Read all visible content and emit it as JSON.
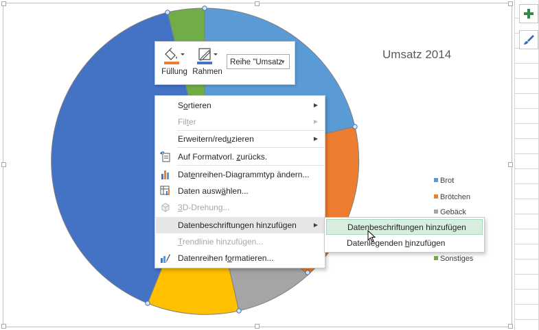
{
  "chart": {
    "title": "Umsatz 2014",
    "legend": [
      {
        "label": "Brot",
        "color": "#5b9bd5"
      },
      {
        "label": "Brötchen",
        "color": "#ed7d31"
      },
      {
        "label": "Gebäck",
        "color": "#a5a5a5"
      },
      {
        "label": "Sonstiges",
        "color": "#70ad47"
      }
    ]
  },
  "minibar": {
    "fill_label": "Füllung",
    "outline_label": "Rahmen",
    "series_select": "Reihe \"Umsatz"
  },
  "context_menu": {
    "items": [
      {
        "pre": "S",
        "u": "o",
        "post": "rtieren",
        "submenu": true,
        "disabled": false
      },
      {
        "pre": "Fil",
        "u": "t",
        "post": "er",
        "submenu": true,
        "disabled": true
      },
      {
        "pre": "Erweitern/red",
        "u": "u",
        "post": "zieren",
        "submenu": true,
        "disabled": false
      },
      {
        "pre": "Auf Formatvorl. ",
        "u": "z",
        "post": "urücks.",
        "submenu": false,
        "disabled": false
      },
      {
        "pre": "Dat",
        "u": "e",
        "post": "nreihen-Diagrammtyp ändern...",
        "submenu": false,
        "disabled": false
      },
      {
        "pre": "Daten ausw",
        "u": "ä",
        "post": "hlen...",
        "submenu": false,
        "disabled": false
      },
      {
        "pre": "",
        "u": "3",
        "post": "D-Drehung...",
        "submenu": false,
        "disabled": true
      },
      {
        "pre": "Datenbeschriftungen hinzufügen",
        "u": "",
        "post": "",
        "submenu": true,
        "disabled": false
      },
      {
        "pre": "",
        "u": "T",
        "post": "rendlinie hinzufügen...",
        "submenu": false,
        "disabled": true
      },
      {
        "pre": "Datenreihen f",
        "u": "o",
        "post": "rmatieren...",
        "submenu": false,
        "disabled": false
      }
    ]
  },
  "submenu": {
    "items": [
      {
        "pre": "Datenbeschriftungen hinzufügen",
        "u": "",
        "post": ""
      },
      {
        "pre": "Datenlegenden ",
        "u": "h",
        "post": "inzufügen"
      }
    ]
  }
}
